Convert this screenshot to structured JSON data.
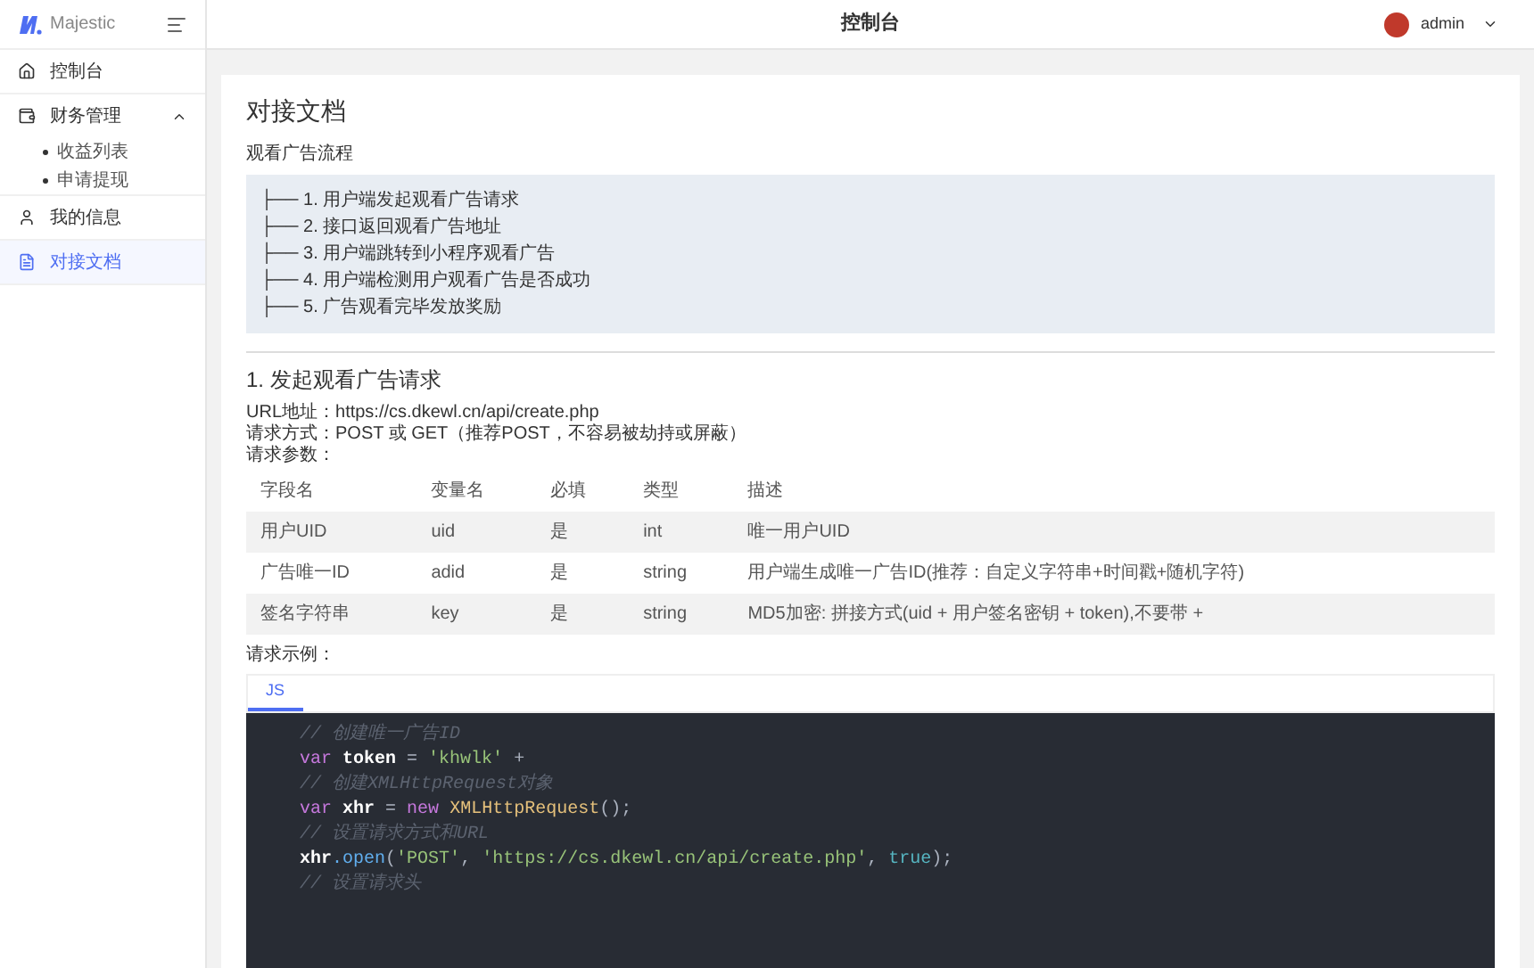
{
  "brand": {
    "name": "Majestic"
  },
  "header": {
    "title": "控制台",
    "user": "admin"
  },
  "sidebar": {
    "items": [
      {
        "label": "控制台",
        "selected": false
      },
      {
        "label": "财务管理",
        "selected": false,
        "expanded": true,
        "children": [
          {
            "label": "收益列表",
            "selected": false
          },
          {
            "label": "申请提现",
            "selected": false
          }
        ]
      },
      {
        "label": "我的信息",
        "selected": false
      },
      {
        "label": "对接文档",
        "selected": true
      }
    ]
  },
  "page": {
    "title": "对接文档",
    "flow_title": "观看广告流程",
    "flow": [
      "├── 1. 用户端发起观看广告请求",
      "├── 2. 接口返回观看广告地址",
      "├── 3. 用户端跳转到小程序观看广告",
      "├── 4. 用户端检测用户观看广告是否成功",
      "├── 5. 广告观看完毕发放奖励"
    ],
    "section_title": "1. 发起观看广告请求",
    "url": "URL地址：https://cs.dkewl.cn/api/create.php",
    "method": "请求方式：POST 或 GET（推荐POST，不容易被劫持或屏蔽）",
    "params_label": "请求参数：",
    "table": {
      "columns": [
        "字段名",
        "变量名",
        "必填",
        "类型",
        "描述"
      ],
      "rows": [
        [
          "用户UID",
          "uid",
          "是",
          "int",
          "唯一用户UID"
        ],
        [
          "广告唯一ID",
          "adid",
          "是",
          "string",
          "用户端生成唯一广告ID(推荐：自定义字符串+时间戳+随机字符)"
        ],
        [
          "签名字符串",
          "key",
          "是",
          "string",
          "MD5加密: 拼接方式(uid + 用户签名密钥 + token),不要带 +"
        ]
      ]
    },
    "example_label": "请求示例：",
    "code_tabs": [
      {
        "label": "JS",
        "selected": true
      }
    ],
    "code_lines": [
      [
        {
          "text": "// 创建唯一广告ID",
          "kind": "comment"
        }
      ],
      [
        {
          "text": "var",
          "kind": "keyword"
        },
        {
          "text": " token",
          "kind": "name"
        },
        {
          "text": " = ",
          "kind": "plain"
        },
        {
          "text": "'khwlk'",
          "kind": "string"
        },
        {
          "text": " +",
          "kind": "plain"
        }
      ],
      [
        {
          "text": "// 创建XMLHttpRequest对象",
          "kind": "comment"
        }
      ],
      [
        {
          "text": "var",
          "kind": "keyword"
        },
        {
          "text": " xhr",
          "kind": "name"
        },
        {
          "text": " = ",
          "kind": "plain"
        },
        {
          "text": "new",
          "kind": "keyword"
        },
        {
          "text": " XMLHttpRequest",
          "kind": "class"
        },
        {
          "text": "();",
          "kind": "plain"
        }
      ],
      [
        {
          "text": "// 设置请求方式和URL",
          "kind": "comment"
        }
      ],
      [
        {
          "text": "xhr",
          "kind": "name"
        },
        {
          "text": ".open",
          "kind": "func"
        },
        {
          "text": "(",
          "kind": "plain"
        },
        {
          "text": "'POST'",
          "kind": "string"
        },
        {
          "text": ", ",
          "kind": "plain"
        },
        {
          "text": "'https://cs.dkewl.cn/api/create.php'",
          "kind": "string"
        },
        {
          "text": ", ",
          "kind": "plain"
        },
        {
          "text": "true",
          "kind": "bool"
        },
        {
          "text": ");",
          "kind": "plain"
        }
      ],
      [
        {
          "text": "// 设置请求头",
          "kind": "comment"
        }
      ]
    ]
  }
}
